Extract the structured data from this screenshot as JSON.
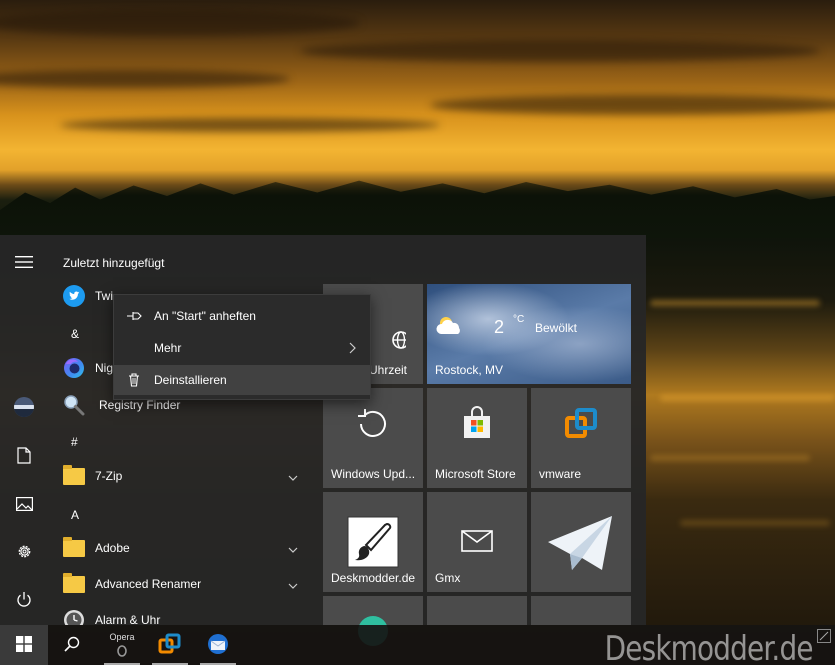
{
  "start_menu": {
    "recently_added_heading": "Zuletzt hinzugefügt",
    "apps": {
      "twitter": "Twi",
      "nightly": "Nig",
      "registry_finder": "Registry Finder",
      "seven_zip": "7-Zip",
      "adobe": "Adobe",
      "advanced_renamer": "Advanced Renamer",
      "alarm": "Alarm & Uhr"
    },
    "letters": {
      "amp": "&",
      "hash": "#",
      "a": "A"
    }
  },
  "context_menu": {
    "pin": "An \"Start\" anheften",
    "more": "Mehr",
    "uninstall": "Deinstallieren"
  },
  "tiles": {
    "clock": "Uhrzeit",
    "weather": {
      "temp": "2",
      "unit": "°C",
      "condition": "Bewölkt",
      "location": "Rostock, MV"
    },
    "windows_update": "Windows Upd...",
    "store": "Microsoft Store",
    "vmware": "vmware",
    "deskmodder": "Deskmodder.de",
    "gmx": "Gmx"
  },
  "taskbar": {
    "opera_label": "Opera",
    "watermark": "Deskmodder.de"
  },
  "colors": {
    "accent_blue": "#1d9bf0",
    "store_red": "#f25022",
    "store_green": "#7fba00",
    "store_blue": "#00a4ef",
    "store_yellow": "#ffb900",
    "vmware_orange": "#f38b00",
    "vmware_blue": "#1d8ccb",
    "telegram": "#2ca5e0"
  }
}
